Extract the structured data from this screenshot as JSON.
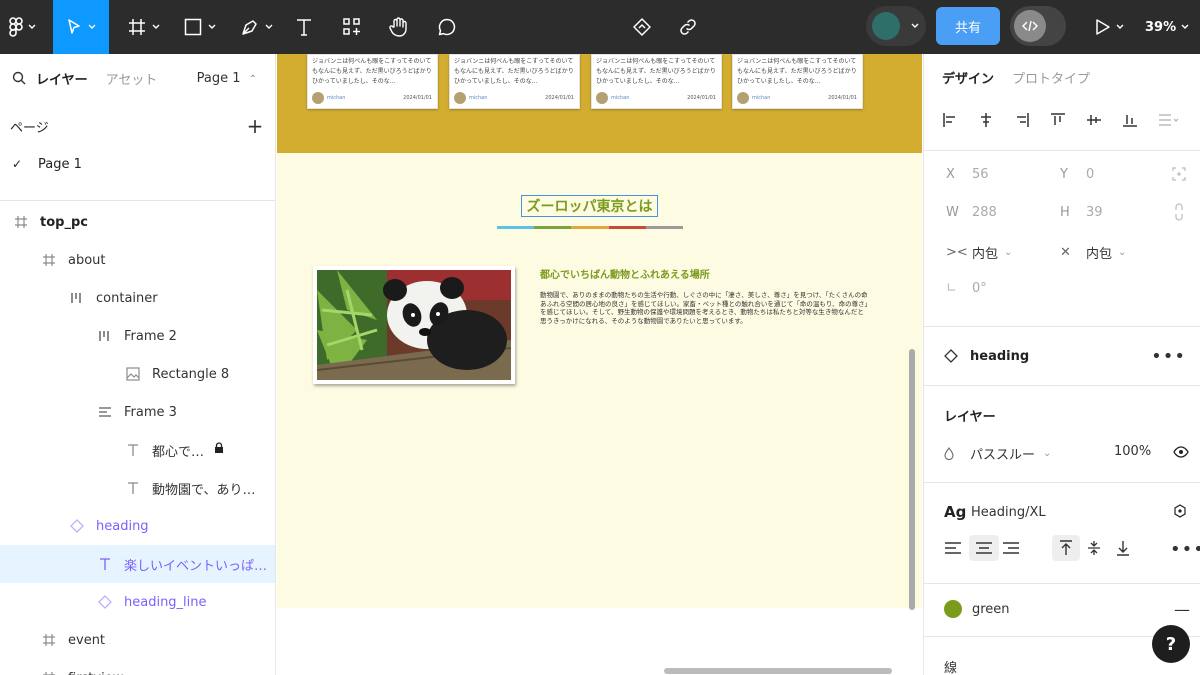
{
  "toolbar": {
    "share_label": "共有",
    "zoom_label": "39%"
  },
  "left_panel": {
    "tab_layers": "レイヤー",
    "tab_assets": "アセット",
    "page_selector": "Page 1",
    "pages_heading": "ページ",
    "pages": [
      "Page 1"
    ],
    "layers": [
      {
        "label": "top_pc",
        "icon": "frame-icon"
      },
      {
        "label": "about",
        "icon": "frame-icon"
      },
      {
        "label": "container",
        "icon": "autolayout-horizontal-icon"
      },
      {
        "label": "Frame 2",
        "icon": "autolayout-horizontal-icon"
      },
      {
        "label": "Rectangle 8",
        "icon": "image-icon"
      },
      {
        "label": "Frame 3",
        "icon": "autolayout-vertical-icon"
      },
      {
        "label": "都心で…",
        "icon": "text-icon"
      },
      {
        "label": "動物園で、あり…",
        "icon": "text-icon"
      },
      {
        "label": "heading",
        "icon": "component-instance-icon"
      },
      {
        "label": "楽しいイベントいっぱ…",
        "icon": "text-icon"
      },
      {
        "label": "heading_line",
        "icon": "component-instance-icon"
      },
      {
        "label": "event",
        "icon": "frame-icon"
      },
      {
        "label": "firstview",
        "icon": "frame-icon"
      }
    ]
  },
  "canvas": {
    "cards": [
      {
        "text": "ジョバンニは何べんも眼をこすってそのいてもなんにも見えず、ただ黒いびろうどばかりひかっていましたし、そのな…",
        "user": "michan",
        "date": "2024/01/01"
      },
      {
        "text": "ジョバンニは何べんも眼をこすってそのいてもなんにも見えず、ただ黒いびろうどばかりひかっていましたし、そのな…",
        "user": "michan",
        "date": "2024/01/01"
      },
      {
        "text": "ジョバンニは何べんも眼をこすってそのいてもなんにも見えず、ただ黒いびろうどばかりひかっていましたし、そのな…",
        "user": "michan",
        "date": "2024/01/01"
      },
      {
        "text": "ジョバンニは何べんも眼をこすってそのいてもなんにも見えず、ただ黒いびろうどばかりひかっていましたし、そのな…",
        "user": "michan",
        "date": "2024/01/01"
      }
    ],
    "heading": "ズーロッパ東京とは",
    "heading_line_colors": [
      "#5bc2e7",
      "#7aa33c",
      "#e0a93a",
      "#c64b3b",
      "#9b9b9b"
    ],
    "sub_heading": "都心でいちばん動物とふれあえる場所",
    "body": "動物園で、ありのままの動物たちの生活や行動、しぐさの中に「凄さ、美しさ、尊さ」を見つけ、「たくさんの命あふれる空間の居心地の良さ」を感じてほしい。家畜・ペット種との触れ合いを通じて「命の温もり、命の尊さ」を感じてほしい。そして、野生動物の保護や環境問題を考えるとき、動物たちは私たちと対等な生き物なんだと思うきっかけになれる、そのような動物園でありたいと思っています。"
  },
  "right_panel": {
    "tab_design": "デザイン",
    "tab_prototype": "プロトタイプ",
    "x_label": "X",
    "x_value": "56",
    "y_label": "Y",
    "y_value": "0",
    "w_label": "W",
    "w_value": "288",
    "h_label": "H",
    "h_value": "39",
    "hug_horizontal": "内包",
    "hug_vertical": "内包",
    "rotation": "0°",
    "component_name": "heading",
    "layer_heading": "レイヤー",
    "blend_mode": "パススルー",
    "opacity": "100%",
    "text_style_icon": "Ag",
    "text_style": "Heading/XL",
    "fill_name": "green",
    "fill_color": "#7a9b1c",
    "stroke_heading": "線"
  }
}
